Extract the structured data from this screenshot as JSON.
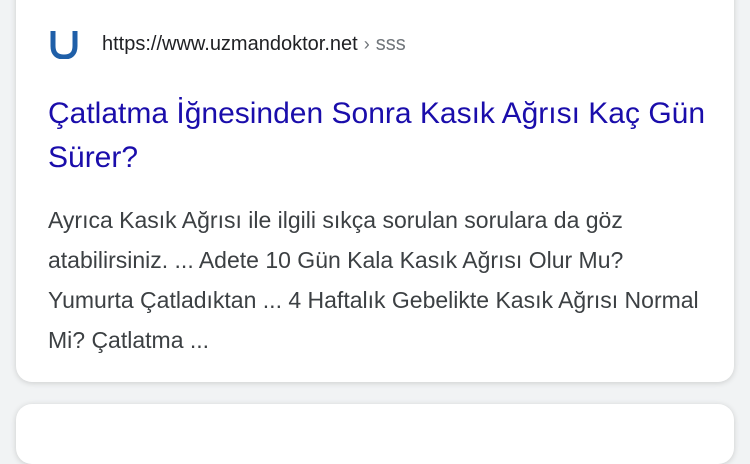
{
  "result": {
    "url": "https://www.uzmandoktor.net",
    "breadcrumb_separator": "›",
    "breadcrumb": "sss",
    "title": "Çatlatma İğnesinden Sonra Kasık Ağrısı Kaç Gün Sürer?",
    "snippet": "Ayrıca Kasık Ağrısı ile ilgili sıkça sorulan sorulara da göz atabilirsiniz. ... Adete 10 Gün Kala Kasık Ağrısı Olur Mu? Yumurta Çatladıktan ... 4 Haftalık Gebelikte Kasık Ağrısı Normal Mi? Çatlatma ...",
    "favicon_icon": "uzmandoktor-u-logo-icon",
    "favicon_color": "#1f5fa8",
    "title_color": "#1a0dab"
  }
}
